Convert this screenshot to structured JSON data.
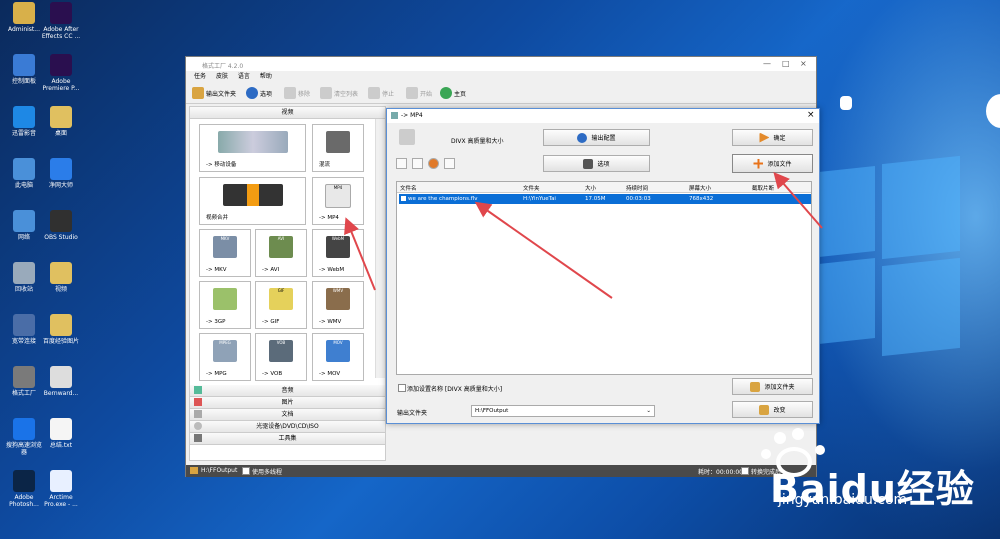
{
  "desktop_icons": [
    {
      "label": "Administ...",
      "color": "#d8b04a"
    },
    {
      "label": "Adobe After Effects CC ...",
      "color": "#2a0f4f"
    },
    {
      "label": "控制面板",
      "color": "#3a7bd5"
    },
    {
      "label": "Adobe Premiere P...",
      "color": "#2a0f4f"
    },
    {
      "label": "迅雷影音",
      "color": "#1e88e5"
    },
    {
      "label": "桌面",
      "color": "#e0c060"
    },
    {
      "label": "此电脑",
      "color": "#4a90d9"
    },
    {
      "label": "净网大师",
      "color": "#2b7de9"
    },
    {
      "label": "网络",
      "color": "#4a90d9"
    },
    {
      "label": "OBS Studio",
      "color": "#303030"
    },
    {
      "label": "回收站",
      "color": "#9ab"
    },
    {
      "label": "视频",
      "color": "#e0c060"
    },
    {
      "label": "宽带连接",
      "color": "#4a6da7"
    },
    {
      "label": "百度经验图片",
      "color": "#e0c060"
    },
    {
      "label": "格式工厂",
      "color": "#7a7a7a"
    },
    {
      "label": "Bernward...",
      "color": "#ddd"
    },
    {
      "label": "搜狗高速浏览器",
      "color": "#1a73e8"
    },
    {
      "label": "总结.txt",
      "color": "#f5f5f5"
    },
    {
      "label": "Adobe Photosh...",
      "color": "#0b2547"
    },
    {
      "label": "Arctime Pro.exe - ...",
      "color": "#e8f0ff"
    }
  ],
  "app": {
    "title": "格式工厂 4.2.0",
    "menu": [
      "任务",
      "皮肤",
      "语言",
      "帮助"
    ],
    "toolbar": [
      "输出文件夹",
      "选项",
      "移除",
      "清空列表",
      "停止",
      "开始",
      "主页"
    ],
    "categories": {
      "video": "视频",
      "audio": "音频",
      "picture": "图片",
      "document": "文档",
      "rom": "光驱设备\\DVD\\CD\\ISO",
      "tools": "工具集"
    },
    "tiles": [
      "-> 移动设备",
      "混流",
      "视频合并",
      "-> MP4",
      "-> MKV",
      "-> AVI",
      "-> WebM",
      "-> 3GP",
      "-> GIF",
      "-> WMV",
      "-> MPG",
      "-> VOB",
      "-> MOV"
    ],
    "tile_badges": [
      "MP4",
      "MKV",
      "AVI",
      "WebM",
      "GIF",
      "WMV",
      "MPEG",
      "VOB",
      "MOV"
    ],
    "status": {
      "folder": "H:\\FFOutput",
      "multithread": "使用多线程",
      "time_label": "耗时：00:00:00",
      "after": "转换完成后"
    }
  },
  "dialog": {
    "title": "-> MP4",
    "profile": "DIVX 高质量和大小",
    "buttons": {
      "output_config": "输出配置",
      "options": "选项",
      "ok": "确定",
      "add_file": "添加文件",
      "add_folder": "添加文件夹",
      "change": "改变"
    },
    "columns": [
      "文件名",
      "文件夹",
      "大小",
      "持续时间",
      "屏幕大小",
      "截取片断"
    ],
    "rows": [
      {
        "name": "we are the champions.flv",
        "folder": "H:\\YinYueTai",
        "size": "17.05M",
        "duration": "00:03:03",
        "screen": "768x432",
        "clip": ""
      }
    ],
    "append_label": "添加设置名称 [DIVX 高质量和大小]",
    "output_label": "输出文件夹",
    "output_path": "H:\\FFOutput"
  },
  "watermark": {
    "brand": "Baidu经验",
    "url": "jingyan.baidu.com"
  },
  "colors": {
    "selection": "#0a6ed6",
    "arrow": "#e0474c",
    "dialog_border": "#5a8fd6"
  }
}
